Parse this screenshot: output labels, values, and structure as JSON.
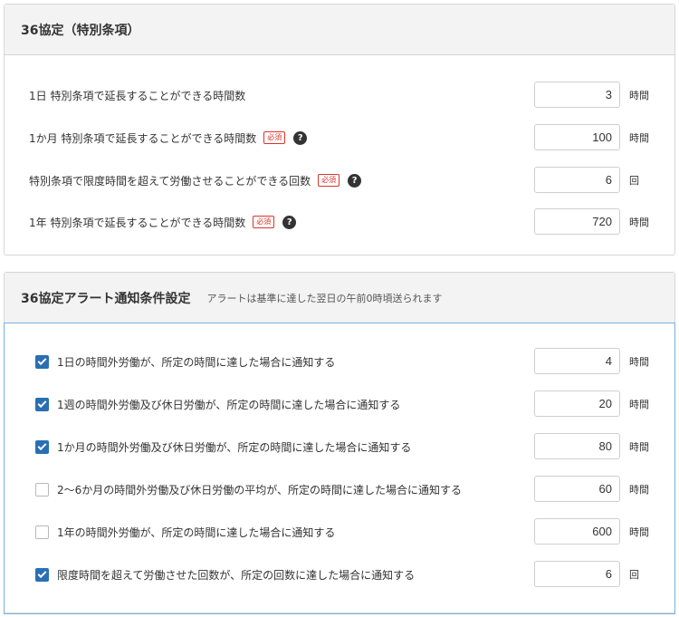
{
  "special": {
    "title": "36協定（特別条項）",
    "rows": [
      {
        "label": "1日 特別条項で延長することができる時間数",
        "required": false,
        "help": false,
        "value": "3",
        "unit": "時間"
      },
      {
        "label": "1か月 特別条項で延長することができる時間数",
        "required": true,
        "help": true,
        "value": "100",
        "unit": "時間"
      },
      {
        "label": "特別条項で限度時間を超えて労働させることができる回数",
        "required": true,
        "help": true,
        "value": "6",
        "unit": "回"
      },
      {
        "label": "1年 特別条項で延長することができる時間数",
        "required": true,
        "help": true,
        "value": "720",
        "unit": "時間"
      }
    ]
  },
  "required_label": "必須",
  "help_glyph": "?",
  "alert": {
    "title": "36協定アラート通知条件設定",
    "note": "アラートは基準に達した翌日の午前0時頃送られます",
    "rows": [
      {
        "label": "1日の時間外労働が、所定の時間に達した場合に通知する",
        "checked": true,
        "value": "4",
        "unit": "時間"
      },
      {
        "label": "1週の時間外労働及び休日労働が、所定の時間に達した場合に通知する",
        "checked": true,
        "value": "20",
        "unit": "時間"
      },
      {
        "label": "1か月の時間外労働及び休日労働が、所定の時間に達した場合に通知する",
        "checked": true,
        "value": "80",
        "unit": "時間"
      },
      {
        "label": "2〜6か月の時間外労働及び休日労働の平均が、所定の時間に達した場合に通知する",
        "checked": false,
        "value": "60",
        "unit": "時間"
      },
      {
        "label": "1年の時間外労働が、所定の時間に達した場合に通知する",
        "checked": false,
        "value": "600",
        "unit": "時間"
      },
      {
        "label": "限度時間を超えて労働させた回数が、所定の回数に達した場合に通知する",
        "checked": true,
        "value": "6",
        "unit": "回"
      }
    ]
  },
  "colors": {
    "accent": "#2a6fb4",
    "required": "#d9342b",
    "focus_border": "#7ab0e0"
  }
}
